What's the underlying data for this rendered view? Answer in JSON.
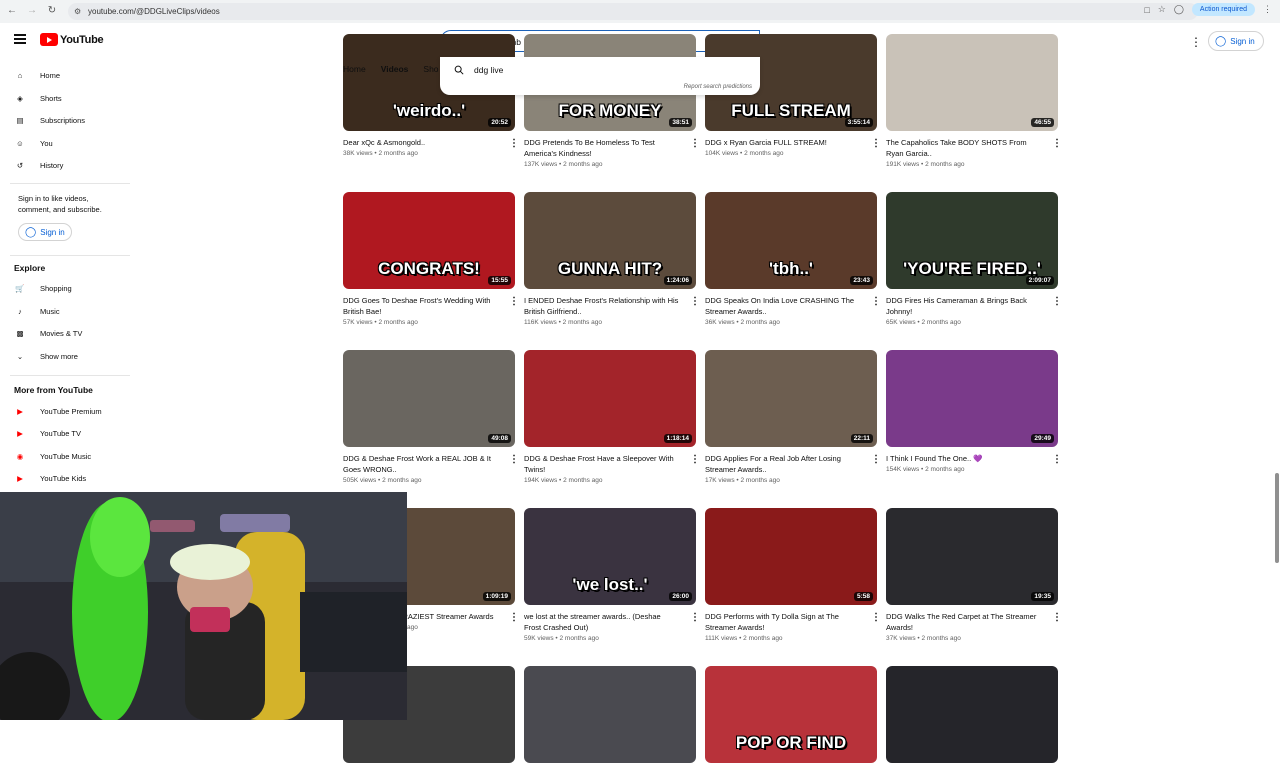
{
  "browser": {
    "url": "youtube.com/@DDGLiveClips/videos",
    "action_pill": "Action required"
  },
  "header": {
    "logo_text": "YouTube",
    "search_value": "ddg live bomb",
    "signin_label": "Sign in"
  },
  "suggestions": {
    "items": [
      "ddg live"
    ],
    "report": "Report search predictions"
  },
  "sidebar": {
    "main": [
      {
        "label": "Home",
        "icon": "home-icon"
      },
      {
        "label": "Shorts",
        "icon": "shorts-icon"
      },
      {
        "label": "Subscriptions",
        "icon": "subscriptions-icon"
      },
      {
        "label": "You",
        "icon": "you-icon"
      },
      {
        "label": "History",
        "icon": "history-icon"
      }
    ],
    "signin_prompt": "Sign in to like videos, comment, and subscribe.",
    "signin_label": "Sign in",
    "explore_header": "Explore",
    "explore": [
      {
        "label": "Shopping",
        "icon": "shopping-icon"
      },
      {
        "label": "Music",
        "icon": "music-icon"
      },
      {
        "label": "Movies & TV",
        "icon": "movies-icon"
      },
      {
        "label": "Show more",
        "icon": "chevron-down-icon"
      }
    ],
    "more_header": "More from YouTube",
    "more": [
      {
        "label": "YouTube Premium"
      },
      {
        "label": "YouTube TV"
      },
      {
        "label": "YouTube Music"
      },
      {
        "label": "YouTube Kids"
      }
    ]
  },
  "tabs": [
    "Home",
    "Videos",
    "Sho"
  ],
  "videos": [
    {
      "title": "Dear xQc & Asmongold..",
      "meta": "38K views • 2 months ago",
      "duration": "20:52",
      "overlay": "'weirdo..'",
      "bg": "#3b2b1e"
    },
    {
      "title": "DDG Pretends To Be Homeless To Test America's Kindness!",
      "meta": "137K views • 2 months ago",
      "duration": "38:51",
      "overlay": "FOR MONEY",
      "bg": "#8a8478"
    },
    {
      "title": "DDG x Ryan Garcia FULL STREAM!",
      "meta": "104K views • 2 months ago",
      "duration": "3:55:14",
      "overlay": "FULL STREAM",
      "bg": "#4a3a2c"
    },
    {
      "title": "The Capaholics Take BODY SHOTS From Ryan Garcia..",
      "meta": "191K views • 2 months ago",
      "duration": "46:55",
      "overlay": "",
      "bg": "#c9c2b8"
    },
    {
      "title": "DDG Goes To Deshae Frost's Wedding With British Bae!",
      "meta": "57K views • 2 months ago",
      "duration": "15:55",
      "overlay": "CONGRATS!",
      "bg": "#b01820"
    },
    {
      "title": "I ENDED Deshae Frost's Relationship with His British Girlfriend..",
      "meta": "116K views • 2 months ago",
      "duration": "1:24:06",
      "overlay": "GUNNA HIT?",
      "bg": "#5c4b3c"
    },
    {
      "title": "DDG Speaks On India Love CRASHING The Streamer Awards..",
      "meta": "36K views • 2 months ago",
      "duration": "23:43",
      "overlay": "'tbh..'",
      "bg": "#5a3a2a"
    },
    {
      "title": "DDG Fires His Cameraman & Brings Back Johnny!",
      "meta": "65K views • 2 months ago",
      "duration": "2:09:07",
      "overlay": "'YOU'RE FIRED..'",
      "bg": "#2f3a2c"
    },
    {
      "title": "DDG & Deshae Frost Work a REAL JOB & It Goes WRONG..",
      "meta": "505K views • 2 months ago",
      "duration": "49:08",
      "overlay": "",
      "bg": "#6a6660"
    },
    {
      "title": "DDG & Deshae Frost Have a Sleepover With Twins!",
      "meta": "194K views • 2 months ago",
      "duration": "1:18:14",
      "overlay": "",
      "bg": "#a3242a"
    },
    {
      "title": "DDG Applies For a Real Job After Losing Streamer Awards..",
      "meta": "17K views • 2 months ago",
      "duration": "22:11",
      "overlay": "",
      "bg": "#6d5e50"
    },
    {
      "title": "I Think I Found The One.. 💜",
      "meta": "154K views • 2 months ago",
      "duration": "29:49",
      "overlay": "",
      "bg": "#7a3a8a"
    },
    {
      "title": "DDG Reacts To CRAZIEST Streamer Awards",
      "meta": "84K views • 2 months ago",
      "duration": "1:09:19",
      "overlay": "",
      "bg": "#5c4a3a"
    },
    {
      "title": "we lost at the streamer awards.. (Deshae Frost Crashed Out)",
      "meta": "59K views • 2 months ago",
      "duration": "26:00",
      "overlay": "'we lost..'",
      "bg": "#3a3340"
    },
    {
      "title": "DDG Performs with Ty Dolla Sign at The Streamer Awards!",
      "meta": "111K views • 2 months ago",
      "duration": "5:58",
      "overlay": "",
      "bg": "#8a1a1a"
    },
    {
      "title": "DDG Walks The Red Carpet at The Streamer Awards!",
      "meta": "37K views • 2 months ago",
      "duration": "19:35",
      "overlay": "",
      "bg": "#2a2a2e"
    },
    {
      "title": "",
      "meta": "",
      "duration": "",
      "overlay": "",
      "bg": "#3c3c3c"
    },
    {
      "title": "",
      "meta": "",
      "duration": "",
      "overlay": "",
      "bg": "#4a4a50"
    },
    {
      "title": "",
      "meta": "",
      "duration": "",
      "overlay": "POP OR FIND",
      "bg": "#b8323a"
    },
    {
      "title": "",
      "meta": "",
      "duration": "",
      "overlay": "",
      "bg": "#25252a"
    }
  ],
  "visible_partial": {
    "row4_col0_title_fragment": "AZIEST Streamer Awards",
    "row4_col0_meta_fragment": "s ago"
  },
  "colors": {
    "brand_red": "#ff0000",
    "link_blue": "#065fd4",
    "focus_blue": "#1c62b9"
  }
}
